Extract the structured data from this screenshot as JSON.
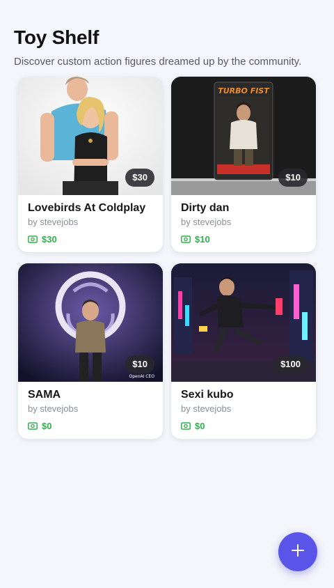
{
  "header": {
    "title": "Toy Shelf",
    "subtitle": "Discover custom action figures dreamed up by the community."
  },
  "toys": [
    {
      "name": "Lovebirds At Coldplay",
      "author": "by stevejobs",
      "price": "$30",
      "earnings": "$30",
      "image": "couple-figure-image"
    },
    {
      "name": "Dirty dan",
      "author": "by stevejobs",
      "price": "$10",
      "earnings": "$10",
      "image": "boxed-figure-image",
      "box_text": "TURBO FIST"
    },
    {
      "name": "SAMA",
      "author": "by stevejobs",
      "price": "$10",
      "earnings": "$0",
      "image": "logo-figure-image",
      "watermark": "OpenAI CEO"
    },
    {
      "name": "Sexi kubo",
      "author": "by stevejobs",
      "price": "$100",
      "earnings": "$0",
      "image": "neon-city-figure-image"
    }
  ],
  "colors": {
    "accent": "#5b54e8",
    "earnings": "#2fb24c",
    "badge": "#28282c"
  },
  "icons": {
    "earnings": "money-icon",
    "fab": "plus-icon"
  }
}
